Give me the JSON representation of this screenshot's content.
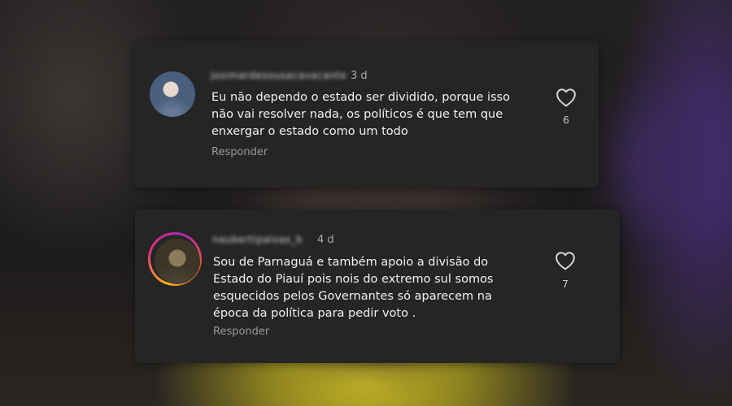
{
  "comments": [
    {
      "username": "josimardesousacavacante",
      "time": "3 d",
      "text_lines": [
        "Eu não dependo o estado ser dividido,  porque isso",
        "não vai resolver nada, os políticos é que tem que",
        "enxergar o estado como um todo"
      ],
      "reply_label": "Responder",
      "likes": "6",
      "like_icon": "heart-outline-icon"
    },
    {
      "username": "naubertipaivas_b",
      "time": "4 d",
      "text_lines": [
        "Sou de Parnaguá e também apoio a divisão do",
        "Estado do Piauí pois nois  do extremo sul somos",
        "esquecidos pelos Governantes só aparecem na",
        "época da política para pedir voto ."
      ],
      "reply_label": "Responder",
      "likes": "7",
      "like_icon": "heart-outline-icon"
    }
  ],
  "colors": {
    "card_background": "#252526",
    "text_primary": "#f2f2f2",
    "text_secondary": "#9a9a9a",
    "story_ring_gradient": [
      "#f9b21a",
      "#e2307d",
      "#b026b5"
    ]
  }
}
